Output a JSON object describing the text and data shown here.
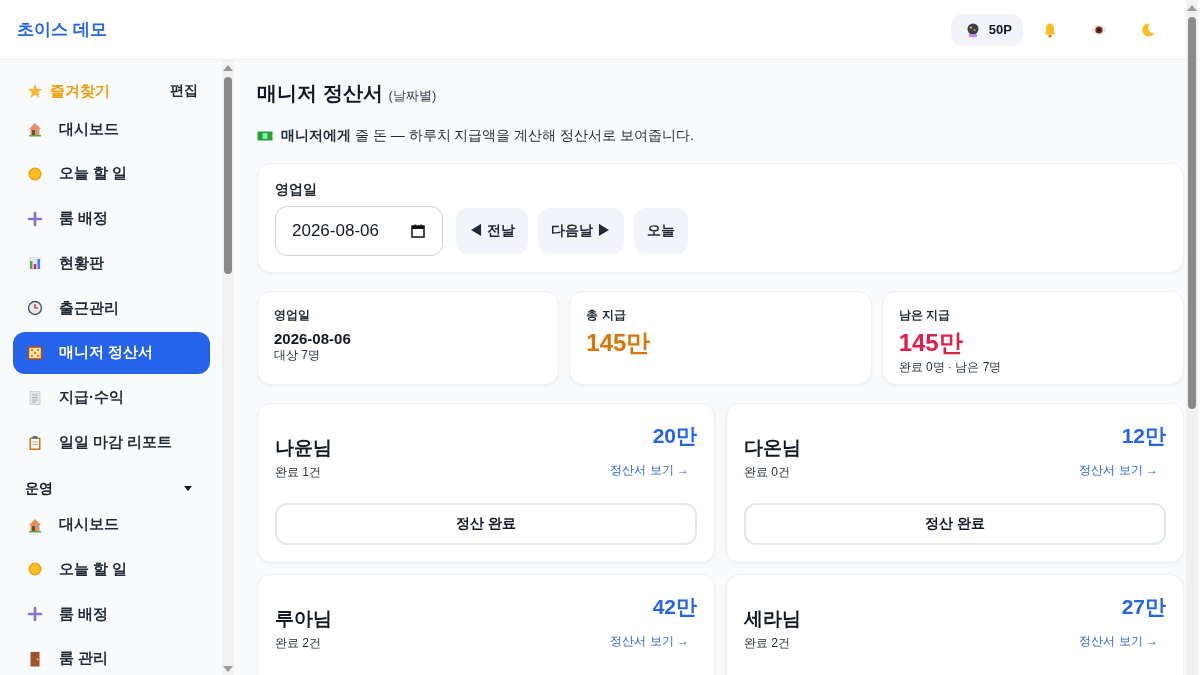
{
  "header": {
    "brand": "초이스 데모",
    "points": "50P"
  },
  "sidebar": {
    "favorites": {
      "title": "즐겨찾기",
      "edit": "편집",
      "items": [
        {
          "label": "대시보드",
          "kind": "house",
          "selected": false
        },
        {
          "label": "오늘 할 일",
          "kind": "sun",
          "selected": false
        },
        {
          "label": "룸 배정",
          "kind": "plus",
          "selected": false
        },
        {
          "label": "현황판",
          "kind": "chart",
          "selected": false
        },
        {
          "label": "출근관리",
          "kind": "clock",
          "selected": false
        },
        {
          "label": "매니저 정산서",
          "kind": "abacus",
          "selected": true
        },
        {
          "label": "지급·수익",
          "kind": "document",
          "selected": false
        },
        {
          "label": "일일 마감 리포트",
          "kind": "clipboard",
          "selected": false
        }
      ]
    },
    "section": {
      "title": "운영",
      "expanded": true,
      "items": [
        {
          "label": "대시보드",
          "kind": "house",
          "selected": false
        },
        {
          "label": "오늘 할 일",
          "kind": "sun",
          "selected": false
        },
        {
          "label": "룸 배정",
          "kind": "plus",
          "selected": false
        },
        {
          "label": "룸 관리",
          "kind": "door",
          "selected": false
        }
      ]
    }
  },
  "page": {
    "title": "매니저 정산서",
    "title_note": "(날짜별)",
    "lead_bold": "매니저에게",
    "lead": "줄 돈 — 하루치 지급액을 계산해 정산서로 보여줍니다."
  },
  "date_picker": {
    "label": "영업일",
    "value": "2026-08-06",
    "buttons": [
      "◀ 전날",
      "다음날 ▶",
      "오늘"
    ]
  },
  "stats": [
    {
      "kind": "date",
      "label": "영업일",
      "value": "2026-08-06",
      "note": "대상 7명"
    },
    {
      "kind": "amount",
      "label": "총 지급",
      "value": "145만",
      "color": "#d97706"
    },
    {
      "kind": "amount",
      "label": "남은 지급",
      "value": "145만",
      "note": "완료 0명 · 남은 7명",
      "color": "#e11d48"
    }
  ],
  "managers": [
    {
      "name": "나윤님",
      "amount": "20만",
      "done": "완료 1건",
      "link": "정산서 보기 →",
      "action": "정산 완료"
    },
    {
      "name": "다온님",
      "amount": "12만",
      "done": "완료 0건",
      "link": "정산서 보기 →",
      "action": "정산 완료"
    },
    {
      "name": "루아님",
      "amount": "42만",
      "done": "완료 2건",
      "link": "정산서 보기 →"
    },
    {
      "name": "세라님",
      "amount": "27만",
      "done": "완료 2건",
      "link": "정산서 보기 →"
    }
  ]
}
